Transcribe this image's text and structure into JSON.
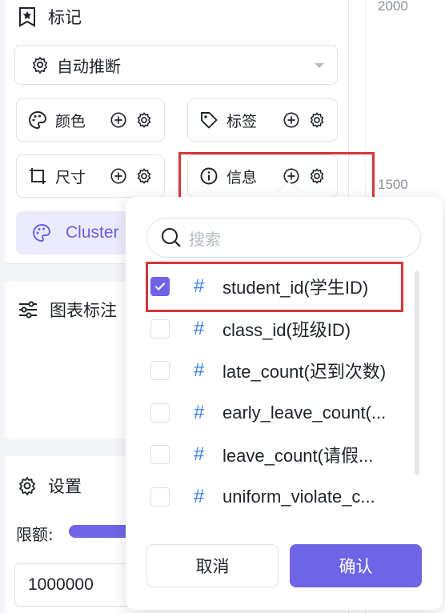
{
  "chart_axis": {
    "tick_2000": "2000",
    "tick_1500": "1500"
  },
  "marks": {
    "title": "标记",
    "mark_type": "自动推断",
    "chips": {
      "color": "颜色",
      "tag": "标签",
      "size": "尺寸",
      "info": "信息"
    },
    "cluster_label": "Cluster"
  },
  "chart_annotation": {
    "title": "图表标注"
  },
  "settings": {
    "title": "设置",
    "quota_label": "限额:",
    "quota_value": "1000000"
  },
  "field_popup": {
    "search_placeholder": "搜索",
    "items": [
      {
        "label": "student_id(学生ID)",
        "checked": true
      },
      {
        "label": "class_id(班级ID)",
        "checked": false
      },
      {
        "label": "late_count(迟到次数)",
        "checked": false
      },
      {
        "label": "early_leave_count(...",
        "checked": false
      },
      {
        "label": "leave_count(请假...",
        "checked": false
      },
      {
        "label": "uniform_violate_c...",
        "checked": false
      }
    ],
    "hash_symbol": "#",
    "cancel": "取消",
    "confirm": "确认"
  },
  "colors": {
    "accent": "#6f63e6",
    "highlight_red": "#d4373a",
    "field_blue": "#3b82e8"
  }
}
